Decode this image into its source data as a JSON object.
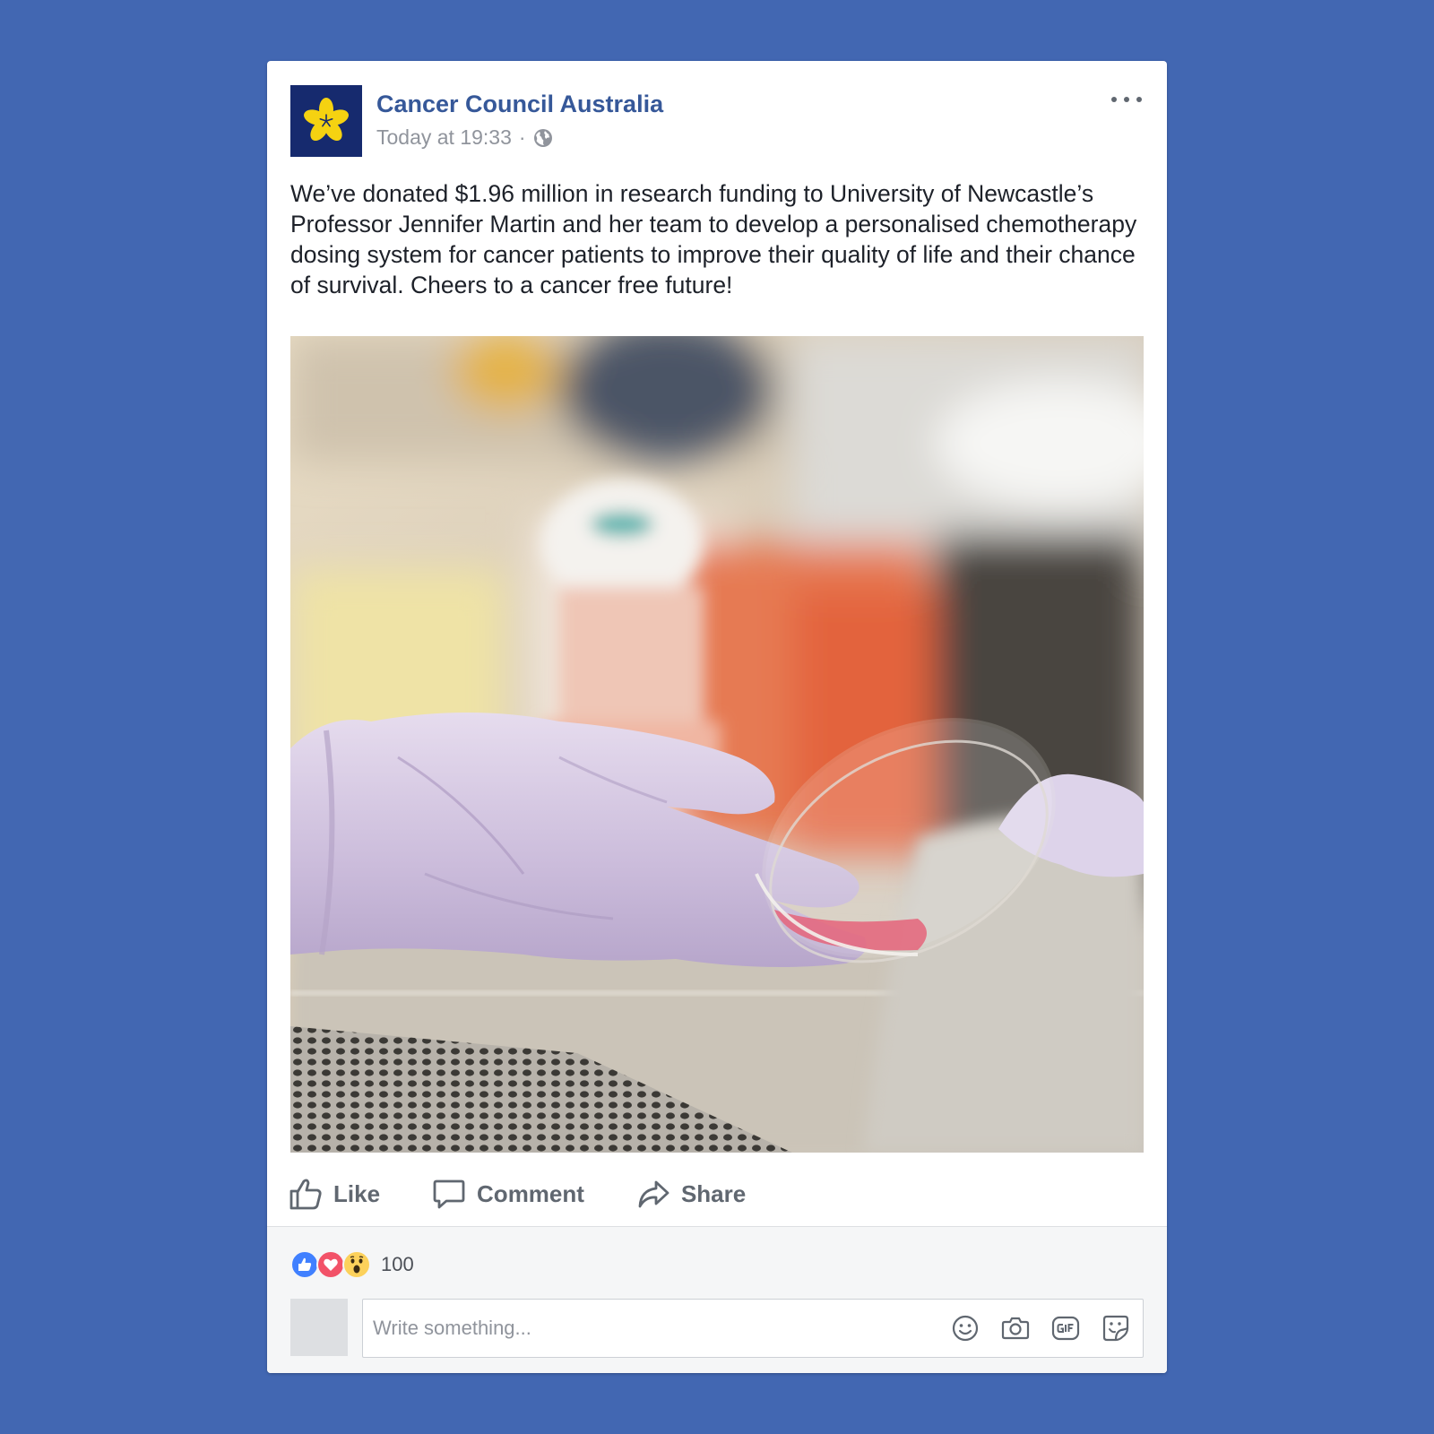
{
  "post": {
    "page_name": "Cancer Council Australia",
    "timestamp": "Today at 19:33",
    "separator": "·",
    "privacy_icon": "globe-icon",
    "more_icon": "more-options-icon",
    "text": "We’ve donated $1.96 million in research funding to University of Newcastle’s Professor Jennifer Martin and her team to develop a personalised chemotherapy dosing system for cancer patients to improve their quality of life and their chance of survival. Cheers to a cancer free future!",
    "image_subject": "gloved hand holding a petri dish in a laboratory"
  },
  "actions": {
    "like_label": "Like",
    "comment_label": "Comment",
    "share_label": "Share"
  },
  "reactions": {
    "types": [
      "like",
      "love",
      "wow"
    ],
    "count": "100"
  },
  "comment": {
    "placeholder": "Write something...",
    "icons": [
      "emoji-icon",
      "camera-icon",
      "gif-icon",
      "sticker-icon"
    ]
  },
  "colors": {
    "background": "#4267b2",
    "page_name": "#365899",
    "logo_bg": "#162a6e",
    "logo_flower": "#f5d211",
    "like_blue": "#4080ff",
    "love_red": "#f25268",
    "wow_yellow": "#fcd15b"
  }
}
